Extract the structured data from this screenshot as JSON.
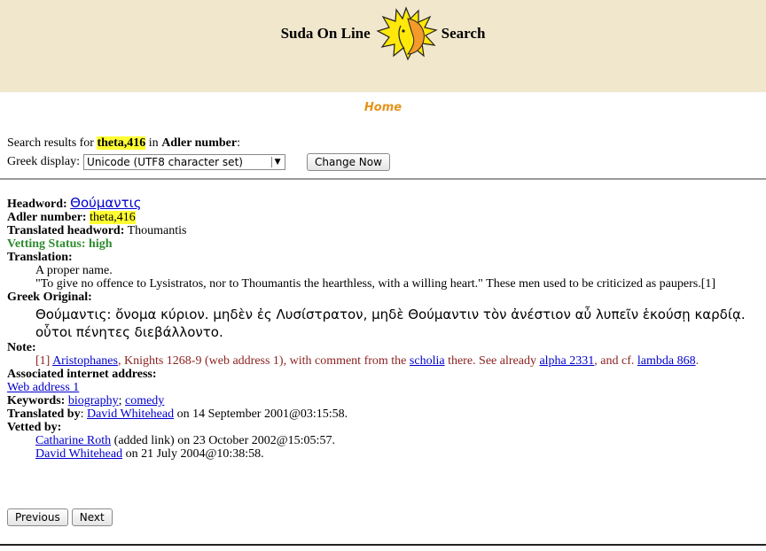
{
  "header": {
    "left_title": "Suda On Line",
    "right_title": "Search",
    "logo_icon": "sun-logo-icon"
  },
  "home_link": "Home",
  "search": {
    "results_prefix": "Search results for",
    "query": "theta,416",
    "in_text": "in",
    "field": "Adler number",
    "colon": ":",
    "display_label": "Greek display:",
    "display_value": "Unicode (UTF8 character set)",
    "change_button": "Change Now"
  },
  "entry": {
    "headword_label": "Headword:",
    "headword": "Θούμαντις",
    "adler_label": "Adler number:",
    "adler_prefix": "theta",
    "adler_number": ",416",
    "translated_label": "Translated headword:",
    "translated": "Thoumantis",
    "vetting": "Vetting Status: high",
    "translation_label": "Translation:",
    "translation_line1": "A proper name.",
    "translation_line2": "\"To give no offence to Lysistratos, nor to Thoumantis the hearthless, with a willing heart.\" These men used to be criticized as paupers.[1]",
    "greek_label": "Greek Original:",
    "greek_text": "Θούμαντις: ὄνομα κύριον. μηδὲν ἐς Λυσίστρατον, μηδὲ Θούμαντιν τὸν ἀνέστιον αὖ λυπεῖν ἑκούσῃ καρδίᾳ. οὗτοι πένητες διεβάλλοντο.",
    "note_label": "Note:",
    "note_num": "[1] ",
    "note_link1": "Aristophanes",
    "note_text1": ", Knights 1268-9 (web address 1), with comment from the ",
    "note_link2": "scholia",
    "note_text2": " there. See already ",
    "note_link3": "alpha 2331",
    "note_text3": ", and cf. ",
    "note_link4": "lambda 868",
    "note_end": ".",
    "assoc_label": "Associated internet address:",
    "assoc_link": "Web address 1",
    "keywords_label": "Keywords:",
    "keyword1": "biography",
    "keyword_sep": "; ",
    "keyword2": "comedy",
    "translated_by_label": "Translated by",
    "translated_by_colon": ": ",
    "translator": "David Whitehead",
    "translated_on": " on 14 September 2001@03:15:58.",
    "vetted_label": "Vetted by:",
    "vetter1": "Catharine Roth",
    "vetter1_text": " (added link) on 23 October 2002@15:05:57.",
    "vetter2": "David Whitehead",
    "vetter2_text": " on 21 July 2004@10:38:58."
  },
  "nav": {
    "previous": "Previous",
    "next": "Next"
  },
  "colors": {
    "banner": "#f1e7cd",
    "highlight": "#ffff33",
    "home": "#e6931a",
    "vetting": "#2e8b2e",
    "note": "#8b1f1f",
    "link": "#0000cc"
  }
}
